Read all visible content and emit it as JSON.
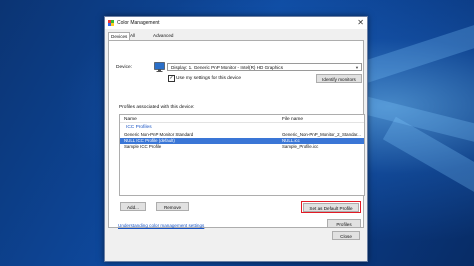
{
  "window": {
    "title": "Color Management",
    "close_glyph": "✕"
  },
  "tabs": [
    {
      "label": "Devices",
      "active": true
    },
    {
      "label": "All Profiles",
      "active": false
    },
    {
      "label": "Advanced",
      "active": false
    }
  ],
  "device": {
    "label": "Device:",
    "selected": "Display: 1. Generic PnP Monitor - Intel(R) HD Graphics",
    "use_settings_label": "Use my settings for this device",
    "use_settings_checked": true,
    "identify_button": "Identify monitors"
  },
  "profiles": {
    "group_label": "Profiles associated with this device:",
    "columns": {
      "name": "Name",
      "file": "File name"
    },
    "group_heading": "ICC Profiles",
    "rows": [
      {
        "name": "Generic Non-PnP Monitor Standard",
        "file": "Generic_Non-PnP_Monitor_2_Standar...",
        "selected": false
      },
      {
        "name": "NULL ICC Profile (default)",
        "file": "NULL.icc",
        "selected": true
      },
      {
        "name": "Sample ICC Profile",
        "file": "Sample_Profile.icc",
        "selected": false
      }
    ]
  },
  "buttons": {
    "add": "Add...",
    "remove": "Remove",
    "set_default": "Set as Default Profile",
    "profiles": "Profiles",
    "close": "Close"
  },
  "footer": {
    "link": "Understanding color management settings"
  },
  "colors": {
    "selection": "#3a76d6",
    "highlight_box": "#e21b25",
    "link": "#1a55c5"
  }
}
